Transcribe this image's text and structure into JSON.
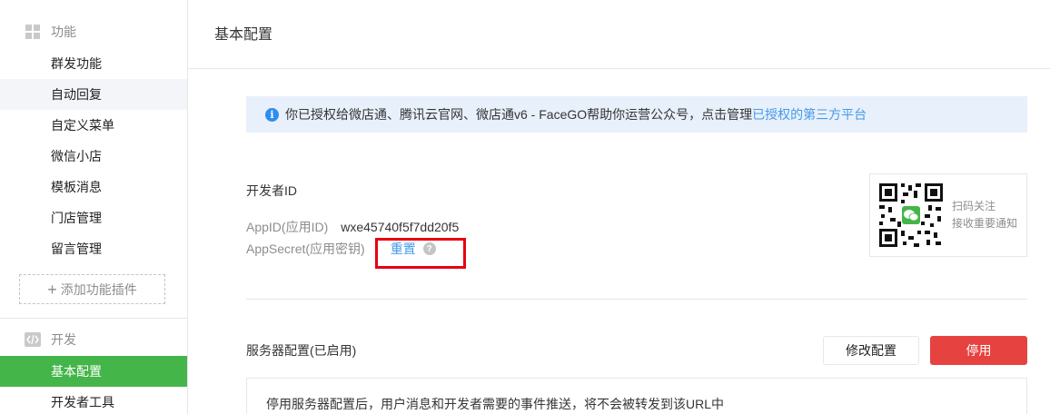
{
  "sidebar": {
    "groups": [
      {
        "title": "功能",
        "icon": "grid-icon",
        "items": [
          {
            "label": "群发功能"
          },
          {
            "label": "自动回复"
          },
          {
            "label": "自定义菜单"
          },
          {
            "label": "微信小店"
          },
          {
            "label": "模板消息"
          },
          {
            "label": "门店管理"
          },
          {
            "label": "留言管理"
          }
        ],
        "add_plugin_label": "添加功能插件"
      },
      {
        "title": "开发",
        "icon": "code-icon",
        "items": [
          {
            "label": "基本配置"
          },
          {
            "label": "开发者工具"
          }
        ]
      }
    ]
  },
  "main": {
    "page_title": "基本配置",
    "notice": {
      "text": "你已授权给微店通、腾讯云官网、微店通v6 - FaceGO帮助你运营公众号，点击管理",
      "link_text": "已授权的第三方平台"
    },
    "developer": {
      "title": "开发者ID",
      "appid_label": "AppID(应用ID)",
      "appid_value": "wxe45740f5f7dd20f5",
      "appsecret_label": "AppSecret(应用密钥)",
      "reset_label": "重置",
      "help_glyph": "?"
    },
    "qr_card": {
      "line1": "扫码关注",
      "line2": "接收重要通知"
    },
    "server": {
      "title": "服务器配置(已启用)",
      "modify_label": "修改配置",
      "stop_label": "停用",
      "description": "停用服务器配置后，用户消息和开发者需要的事件推送，将不会被转发到该URL中"
    }
  },
  "colors": {
    "accent_green": "#44b549",
    "link_blue": "#459ae9",
    "danger_red": "#e64340",
    "highlight_box": "#e60012"
  }
}
